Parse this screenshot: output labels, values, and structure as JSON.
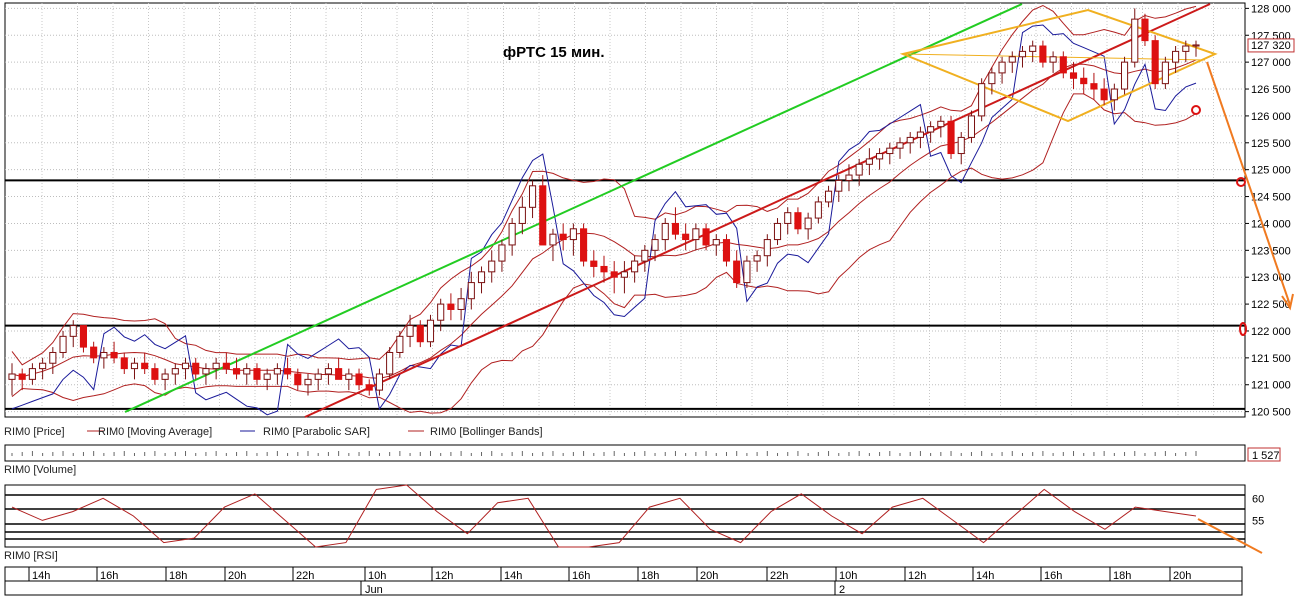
{
  "chart_data": {
    "type": "candlestick",
    "title": "фРТС   15 мин.",
    "price_axis": {
      "ylim": [
        120400,
        128100
      ],
      "ticks": [
        "120 500",
        "121 000",
        "121 500",
        "122 000",
        "122 500",
        "123 000",
        "123 500",
        "124 000",
        "124 500",
        "125 000",
        "125 500",
        "126 000",
        "126 500",
        "127 000",
        "127 500",
        "128 000"
      ],
      "tick_values": [
        120500,
        121000,
        121500,
        122000,
        122500,
        123000,
        123500,
        124000,
        124500,
        125000,
        125500,
        126000,
        126500,
        127000,
        127500,
        128000
      ],
      "last_price_label": "127 320",
      "last_price": 127320
    },
    "volume_axis": {
      "last_label": "1 527"
    },
    "rsi_axis": {
      "ticks": [
        "60",
        "55"
      ],
      "tick_values": [
        60,
        55
      ],
      "ylim": [
        49,
        63
      ]
    },
    "legend": [
      "RIM0 [Price]",
      "RIM0 [Moving Average]",
      "RIM0 [Parabolic SAR]",
      "RIM0 [Bollinger Bands]"
    ],
    "volume_label": "RIM0 [Volume]",
    "rsi_label": "RIM0 [RSI]",
    "time_ticks": [
      "14h",
      "16h",
      "18h",
      "20h",
      "22h",
      "10h",
      "12h",
      "14h",
      "16h",
      "18h",
      "20h",
      "22h",
      "10h",
      "12h",
      "14h",
      "16h",
      "18h",
      "20h"
    ],
    "date_labels": [
      "Jun",
      "2"
    ],
    "horizontal_levels": [
      124800,
      122100,
      120550
    ],
    "candles": [
      [
        121100,
        121400,
        120800,
        121200
      ],
      [
        121200,
        121300,
        120900,
        121100
      ],
      [
        121100,
        121400,
        121000,
        121300
      ],
      [
        121300,
        121500,
        121100,
        121400
      ],
      [
        121400,
        121700,
        121200,
        121600
      ],
      [
        121600,
        122000,
        121500,
        121900
      ],
      [
        121900,
        122200,
        121700,
        122100
      ],
      [
        122100,
        122100,
        121600,
        121700
      ],
      [
        121700,
        121800,
        121400,
        121500
      ],
      [
        121500,
        121700,
        121300,
        121600
      ],
      [
        121600,
        121800,
        121400,
        121500
      ],
      [
        121500,
        121600,
        121200,
        121300
      ],
      [
        121300,
        121500,
        121100,
        121400
      ],
      [
        121400,
        121600,
        121200,
        121300
      ],
      [
        121300,
        121400,
        121000,
        121100
      ],
      [
        121100,
        121300,
        120900,
        121200
      ],
      [
        121200,
        121400,
        121000,
        121300
      ],
      [
        121300,
        121500,
        121100,
        121400
      ],
      [
        121400,
        121500,
        121100,
        121200
      ],
      [
        121200,
        121400,
        121000,
        121300
      ],
      [
        121300,
        121500,
        121100,
        121400
      ],
      [
        121400,
        121600,
        121200,
        121300
      ],
      [
        121300,
        121500,
        121100,
        121200
      ],
      [
        121200,
        121400,
        121000,
        121300
      ],
      [
        121300,
        121400,
        121000,
        121100
      ],
      [
        121100,
        121300,
        120900,
        121200
      ],
      [
        121200,
        121400,
        121000,
        121300
      ],
      [
        121300,
        121500,
        121100,
        121200
      ],
      [
        121200,
        121300,
        120900,
        121000
      ],
      [
        121000,
        121200,
        120800,
        121100
      ],
      [
        121100,
        121300,
        120900,
        121200
      ],
      [
        121200,
        121400,
        121000,
        121300
      ],
      [
        121300,
        121500,
        121100,
        121100
      ],
      [
        121100,
        121300,
        120900,
        121200
      ],
      [
        121200,
        121300,
        120900,
        121000
      ],
      [
        121000,
        121100,
        120800,
        120900
      ],
      [
        120900,
        121300,
        120800,
        121200
      ],
      [
        121200,
        121700,
        121100,
        121600
      ],
      [
        121600,
        122000,
        121500,
        121900
      ],
      [
        121900,
        122300,
        121700,
        122100
      ],
      [
        122100,
        122200,
        121700,
        121800
      ],
      [
        121800,
        122300,
        121700,
        122200
      ],
      [
        122200,
        122600,
        122000,
        122500
      ],
      [
        122500,
        122700,
        122200,
        122400
      ],
      [
        122400,
        122800,
        122200,
        122600
      ],
      [
        122600,
        123100,
        122400,
        122900
      ],
      [
        122900,
        123200,
        122700,
        123100
      ],
      [
        123100,
        123500,
        122900,
        123300
      ],
      [
        123300,
        123700,
        123100,
        123600
      ],
      [
        123600,
        124100,
        123400,
        124000
      ],
      [
        124000,
        124500,
        123800,
        124300
      ],
      [
        124300,
        124800,
        124100,
        124700
      ],
      [
        124700,
        124900,
        123600,
        123600
      ],
      [
        123600,
        123900,
        123300,
        123800
      ],
      [
        123800,
        124000,
        123500,
        123700
      ],
      [
        123700,
        124000,
        123400,
        123900
      ],
      [
        123900,
        124000,
        123200,
        123300
      ],
      [
        123300,
        123500,
        123000,
        123200
      ],
      [
        123200,
        123400,
        122900,
        123100
      ],
      [
        123100,
        123300,
        122700,
        123000
      ],
      [
        123000,
        123300,
        122700,
        123100
      ],
      [
        123100,
        123400,
        122900,
        123300
      ],
      [
        123300,
        123600,
        123100,
        123500
      ],
      [
        123500,
        123800,
        123300,
        123700
      ],
      [
        123700,
        124100,
        123500,
        124000
      ],
      [
        124000,
        124300,
        123700,
        123800
      ],
      [
        123800,
        124000,
        123500,
        123700
      ],
      [
        123700,
        124000,
        123500,
        123900
      ],
      [
        123900,
        124000,
        123500,
        123600
      ],
      [
        123600,
        123800,
        123400,
        123700
      ],
      [
        123700,
        123800,
        123200,
        123300
      ],
      [
        123300,
        123500,
        122800,
        122900
      ],
      [
        122900,
        123400,
        122800,
        123300
      ],
      [
        123300,
        123500,
        123100,
        123400
      ],
      [
        123400,
        123800,
        123200,
        123700
      ],
      [
        123700,
        124100,
        123600,
        124000
      ],
      [
        124000,
        124300,
        123800,
        124200
      ],
      [
        124200,
        124300,
        123800,
        123900
      ],
      [
        123900,
        124200,
        123700,
        124100
      ],
      [
        124100,
        124500,
        124000,
        124400
      ],
      [
        124400,
        124700,
        124300,
        124600
      ],
      [
        124600,
        124900,
        124400,
        124800
      ],
      [
        124800,
        125100,
        124600,
        124900
      ],
      [
        124900,
        125200,
        124700,
        125100
      ],
      [
        125100,
        125400,
        124900,
        125200
      ],
      [
        125200,
        125400,
        125000,
        125300
      ],
      [
        125300,
        125500,
        125100,
        125400
      ],
      [
        125400,
        125600,
        125200,
        125500
      ],
      [
        125500,
        125700,
        125300,
        125600
      ],
      [
        125600,
        125800,
        125400,
        125700
      ],
      [
        125700,
        125900,
        125500,
        125800
      ],
      [
        125800,
        126000,
        125600,
        125900
      ],
      [
        125900,
        126000,
        125200,
        125300
      ],
      [
        125300,
        125700,
        125100,
        125600
      ],
      [
        125600,
        126100,
        125500,
        126000
      ],
      [
        126000,
        126700,
        125900,
        126600
      ],
      [
        126600,
        126900,
        126400,
        126800
      ],
      [
        126800,
        127100,
        126600,
        127000
      ],
      [
        127000,
        127200,
        126800,
        127100
      ],
      [
        127100,
        127300,
        126900,
        127200
      ],
      [
        127200,
        127400,
        127000,
        127300
      ],
      [
        127300,
        127400,
        126900,
        127000
      ],
      [
        127000,
        127200,
        126800,
        127100
      ],
      [
        127100,
        127200,
        126700,
        126800
      ],
      [
        126800,
        127000,
        126500,
        126700
      ],
      [
        126700,
        126900,
        126400,
        126600
      ],
      [
        126600,
        126800,
        126300,
        126500
      ],
      [
        126500,
        126700,
        126200,
        126300
      ],
      [
        126300,
        126600,
        126100,
        126500
      ],
      [
        126500,
        127100,
        126400,
        127000
      ],
      [
        127000,
        128000,
        126900,
        127800
      ],
      [
        127800,
        127900,
        127300,
        127400
      ],
      [
        127400,
        127500,
        126500,
        126600
      ],
      [
        126600,
        127100,
        126500,
        127000
      ],
      [
        127000,
        127300,
        126800,
        127200
      ],
      [
        127200,
        127400,
        127000,
        127300
      ],
      [
        127300,
        127400,
        127100,
        127320
      ]
    ],
    "rsi_values": [
      58,
      55,
      57,
      60,
      56,
      50,
      51,
      58,
      61,
      55,
      49,
      50,
      62,
      64,
      57,
      52,
      59,
      60,
      48,
      46,
      50,
      58,
      60,
      53,
      50,
      57,
      61,
      56,
      52,
      58,
      60,
      55,
      50,
      56,
      62,
      57,
      53,
      58,
      57,
      56
    ]
  }
}
